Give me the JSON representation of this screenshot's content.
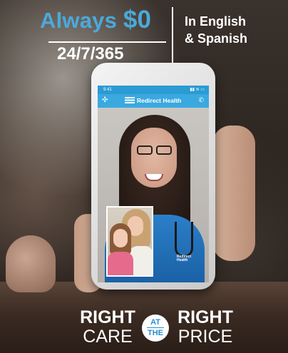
{
  "header": {
    "headline_prefix": "Always ",
    "headline_amount": "$0",
    "hours": "24/7/365",
    "languages_line1": "In English",
    "languages_line2": "& Spanish"
  },
  "phone": {
    "status_time": "9:41",
    "status_icons": "▮▮ ≋ ▭",
    "brand_name": "Redirect Health",
    "scrub_logo_line1": "Redirect",
    "scrub_logo_line2": "Health"
  },
  "tagline": {
    "left_strong": "RIGHT",
    "left_light": "CARE",
    "badge_top": "AT",
    "badge_bottom": "THE",
    "right_strong": "RIGHT",
    "right_light": "PRICE"
  },
  "colors": {
    "accent_blue": "#4ba9da",
    "app_bar_blue": "#3aa9e0"
  },
  "icons": [
    "menu-icon",
    "phone-call-icon",
    "redirect-health-logo-icon",
    "signal-icon",
    "wifi-icon",
    "battery-icon"
  ]
}
